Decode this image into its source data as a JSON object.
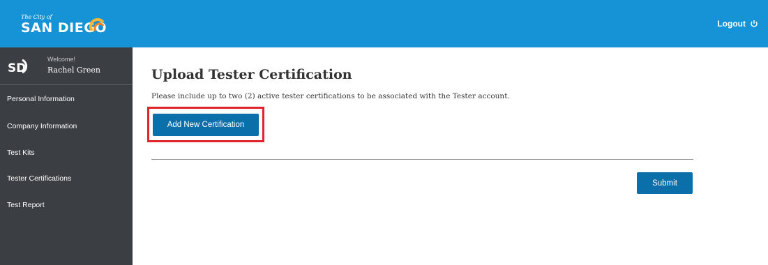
{
  "header": {
    "logo_small": "The City of",
    "logo_big": "SAN DIEGO",
    "logout_label": "Logout",
    "logout_icon": "power-icon",
    "background": "#1693d6"
  },
  "sidebar": {
    "logo_icon": "sd-logo-icon",
    "welcome": "Welcome!",
    "username": "Rachel Green",
    "items": [
      {
        "label": "Personal Information"
      },
      {
        "label": "Company Information"
      },
      {
        "label": "Test Kits"
      },
      {
        "label": "Tester Certifications"
      },
      {
        "label": "Test Report"
      }
    ],
    "background": "#3b3f43"
  },
  "main": {
    "title": "Upload Tester Certification",
    "description": "Please include up to two (2) active tester certifications to be associated with the Tester account.",
    "add_button_label": "Add New Certification",
    "submit_label": "Submit",
    "button_color": "#0b70aa",
    "highlight_color": "#e0242b"
  }
}
